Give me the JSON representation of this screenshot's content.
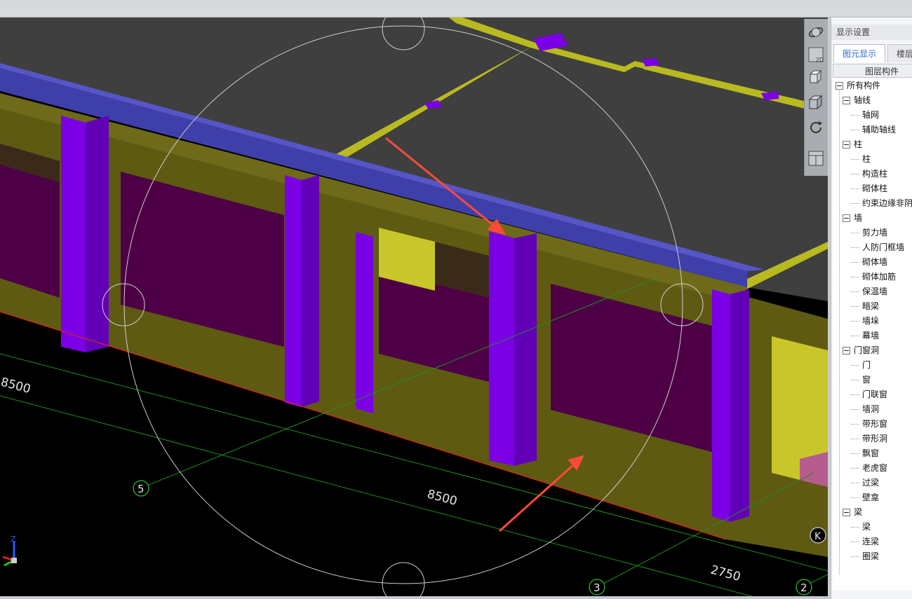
{
  "panel": {
    "title": "显示设置",
    "tabs": [
      "图元显示",
      "楼层"
    ],
    "tree_header": "图层构件"
  },
  "tree": [
    {
      "label": "所有构件",
      "level": 0,
      "toggle": true
    },
    {
      "label": "轴线",
      "level": 1,
      "toggle": true
    },
    {
      "label": "轴网",
      "level": 2,
      "toggle": false
    },
    {
      "label": "辅助轴线",
      "level": 2,
      "toggle": false
    },
    {
      "label": "柱",
      "level": 1,
      "toggle": true
    },
    {
      "label": "柱",
      "level": 2,
      "toggle": false
    },
    {
      "label": "构造柱",
      "level": 2,
      "toggle": false
    },
    {
      "label": "砌体柱",
      "level": 2,
      "toggle": false
    },
    {
      "label": "约束边缘非阴",
      "level": 2,
      "toggle": false
    },
    {
      "label": "墙",
      "level": 1,
      "toggle": true
    },
    {
      "label": "剪力墙",
      "level": 2,
      "toggle": false
    },
    {
      "label": "人防门框墙",
      "level": 2,
      "toggle": false
    },
    {
      "label": "砌体墙",
      "level": 2,
      "toggle": false
    },
    {
      "label": "砌体加筋",
      "level": 2,
      "toggle": false
    },
    {
      "label": "保温墙",
      "level": 2,
      "toggle": false
    },
    {
      "label": "暗梁",
      "level": 2,
      "toggle": false
    },
    {
      "label": "墙垛",
      "level": 2,
      "toggle": false
    },
    {
      "label": "幕墙",
      "level": 2,
      "toggle": false
    },
    {
      "label": "门窗洞",
      "level": 1,
      "toggle": true
    },
    {
      "label": "门",
      "level": 2,
      "toggle": false
    },
    {
      "label": "窗",
      "level": 2,
      "toggle": false
    },
    {
      "label": "门联窗",
      "level": 2,
      "toggle": false
    },
    {
      "label": "墙洞",
      "level": 2,
      "toggle": false
    },
    {
      "label": "带形窗",
      "level": 2,
      "toggle": false
    },
    {
      "label": "带形洞",
      "level": 2,
      "toggle": false
    },
    {
      "label": "飘窗",
      "level": 2,
      "toggle": false
    },
    {
      "label": "老虎窗",
      "level": 2,
      "toggle": false
    },
    {
      "label": "过梁",
      "level": 2,
      "toggle": false
    },
    {
      "label": "壁龛",
      "level": 2,
      "toggle": false
    },
    {
      "label": "梁",
      "level": 1,
      "toggle": true
    },
    {
      "label": "梁",
      "level": 2,
      "toggle": false
    },
    {
      "label": "连梁",
      "level": 2,
      "toggle": false
    },
    {
      "label": "圈梁",
      "level": 2,
      "toggle": false
    }
  ],
  "viewport": {
    "dimensions": [
      "8500",
      "8500",
      "2750"
    ],
    "axis_labels": [
      "5",
      "3",
      "2",
      "K"
    ],
    "gizmo_z": "Z"
  },
  "toolbar": {
    "view_2d_label": "2D"
  },
  "colors": {
    "wall": "#5e5a12",
    "column": "#7b00e6",
    "beam": "#3f3faa",
    "slab": "#3f3f3f",
    "opening": "#4d0046",
    "grid": "#1f8f1f",
    "axis_line": "#b9ba20",
    "arrow": "#ff4a3a"
  }
}
